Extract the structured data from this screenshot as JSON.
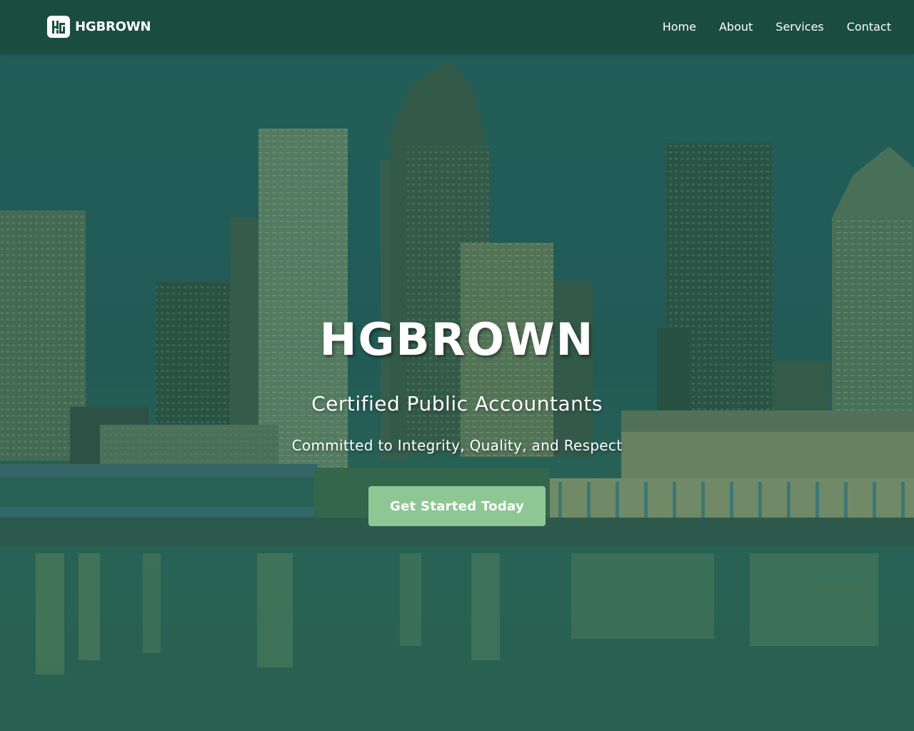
{
  "header": {
    "brand_name": "HGBROWN",
    "logo_icon": "hgb-monogram-icon",
    "nav": [
      {
        "label": "Home"
      },
      {
        "label": "About"
      },
      {
        "label": "Services"
      },
      {
        "label": "Contact"
      }
    ]
  },
  "hero": {
    "title": "HGBROWN",
    "subtitle": "Certified Public Accountants",
    "tagline": "Committed to Integrity, Quality, and Respect",
    "cta_label": "Get Started Today",
    "background_image": "city-skyline-waterfront-image"
  },
  "colors": {
    "header_bg": "#1a4d3e",
    "hero_overlay": "#235f50",
    "cta_bg": "#8ec793",
    "text": "#ffffff"
  }
}
